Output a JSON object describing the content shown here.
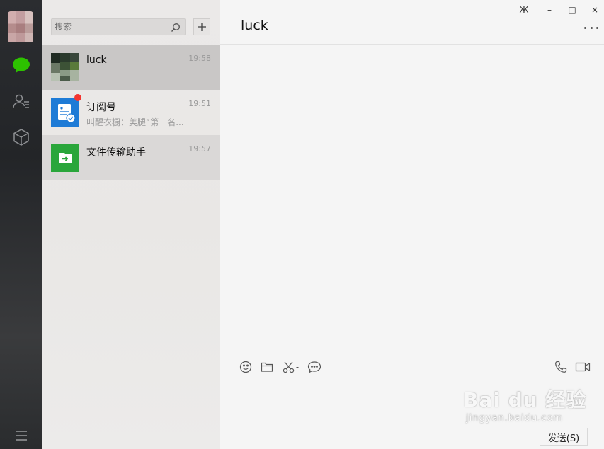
{
  "sidebar": {
    "icons": [
      "chat-icon",
      "contacts-icon",
      "favorites-icon",
      "menu-icon"
    ],
    "accent_color": "#2dc100"
  },
  "search": {
    "placeholder": "搜索"
  },
  "chat_list": [
    {
      "name": "luck",
      "time": "19:58",
      "preview": "",
      "state": "active"
    },
    {
      "name": "订阅号",
      "time": "19:51",
      "preview": "叫醒衣橱：美腿“第一名...",
      "unread": true,
      "icon": "subscription-icon",
      "icon_color": "#1e7bd6"
    },
    {
      "name": "文件传输助手",
      "time": "19:57",
      "preview": "",
      "icon": "file-transfer-icon",
      "icon_color": "#2aa63b"
    }
  ],
  "chat": {
    "title": "luck",
    "send_label": "发送(S)",
    "toolbar": [
      "emoji-icon",
      "folder-icon",
      "scissors-icon",
      "chat-history-icon",
      "phone-icon",
      "video-icon"
    ]
  },
  "window": {
    "pin": "Ж",
    "min": "–",
    "max": "□",
    "close": "×"
  },
  "watermark": {
    "brand": "Bai du 经验",
    "url": "jingyan.baidu.com"
  }
}
